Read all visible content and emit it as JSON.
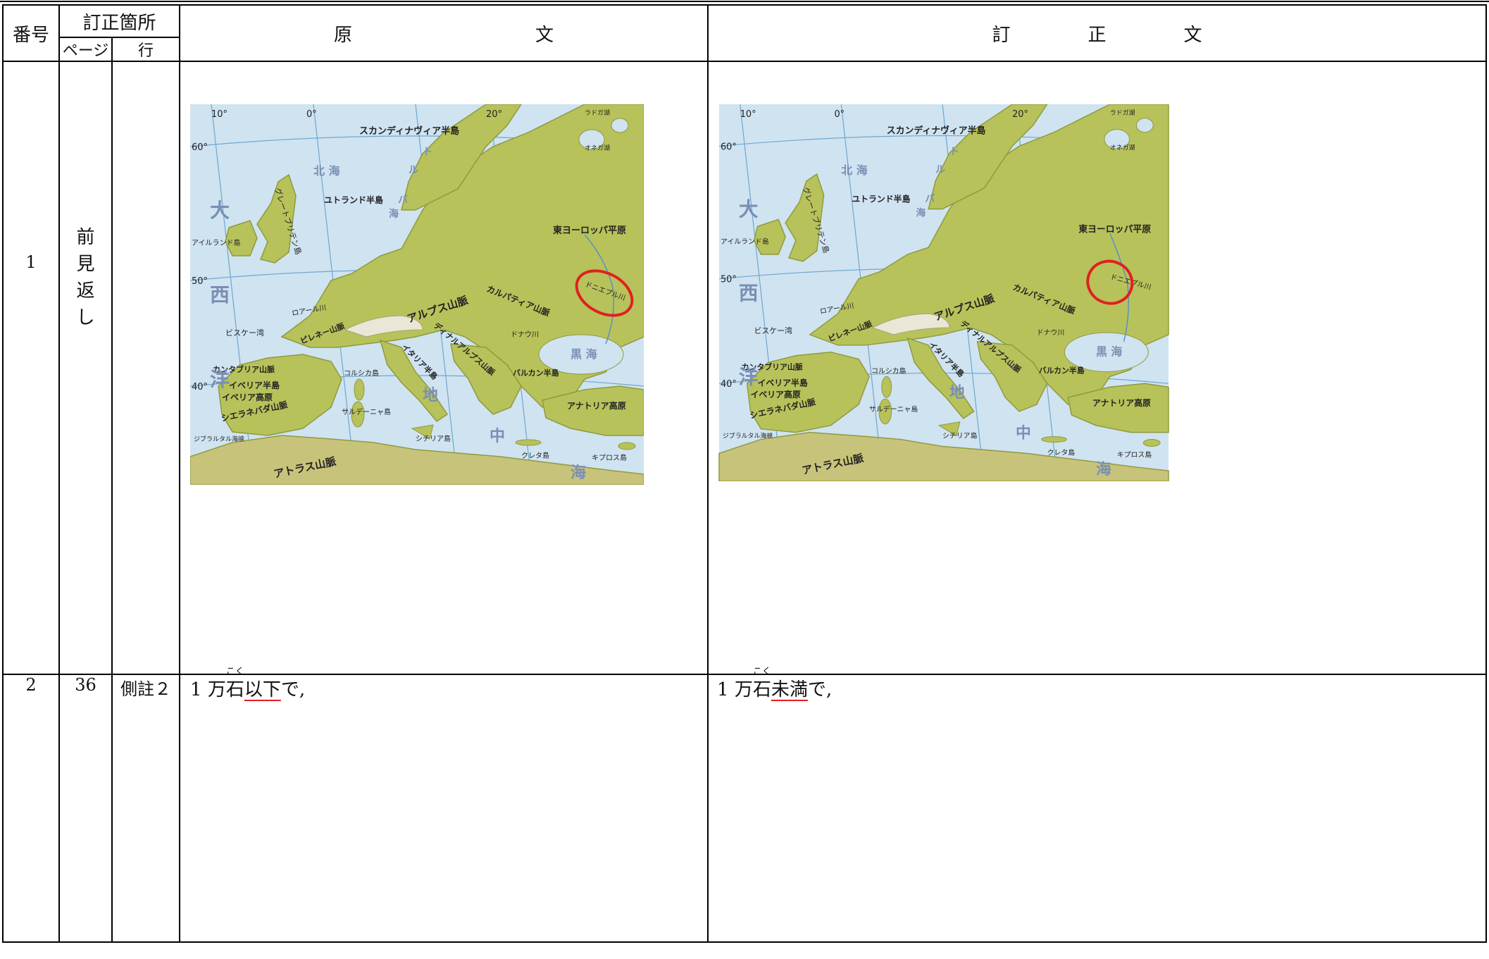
{
  "header": {
    "no_label": "番号",
    "location_label": "訂正箇所",
    "page_label": "ページ",
    "line_label": "行",
    "original_label_chars": [
      "原",
      "文"
    ],
    "corrected_label_chars": [
      "訂",
      "正",
      "文"
    ]
  },
  "rows": [
    {
      "no": "1",
      "page_chars": [
        "前",
        "見",
        "返",
        "し"
      ],
      "line": "",
      "map_labels": {
        "scandinavia": "スカンディナヴィア半島",
        "great_britain": "グレートブリテン島",
        "jutland": "ユトランド半島",
        "ireland": "アイルランド島",
        "east_europe_plain": "東ヨーロッパ平原",
        "original_river": "ドニエプル川",
        "corrected_river": "ドニエプル川",
        "alps": "アルプス山脈",
        "carpathians": "カルパティア山脈",
        "dinaric": "ディナルアルプス山脈",
        "pyrenees": "ピレネー山脈",
        "cantabrian": "カンタブリア山脈",
        "iberian_pen": "イベリア半島",
        "iberian_plateau": "イベリア高原",
        "sierra_nevada": "シエラネバダ山脈",
        "corsica": "コルシカ島",
        "sardinia": "サルデーニャ島",
        "sicily": "シチリア島",
        "italian_pen": "イタリア半島",
        "balkan": "バルカン半島",
        "anatolia": "アナトリア高原",
        "crete": "クレタ島",
        "cyprus": "キプロス島",
        "atlas": "アトラス山脈",
        "biscay": "ビスケー湾",
        "gibraltar": "ジブラルタル海峡",
        "ladoga": "ラドガ湖",
        "onega": "オネガ湖",
        "loire": "ロアール川",
        "danube": "ドナウ川",
        "ocean_chars": [
          "大",
          "西",
          "洋"
        ],
        "north_sea": "北 海",
        "baltic_chars": [
          "バ",
          "ル",
          "ト",
          "海"
        ],
        "black_sea": "黒 海",
        "med_chars": [
          "地",
          "中",
          "海"
        ],
        "lat_60": "60°",
        "lat_50": "50°",
        "lat_40": "40°",
        "lon_10w": "10°",
        "lon_0": "0°",
        "lon_20": "20°"
      }
    },
    {
      "no": "2",
      "page": "36",
      "line": "側註２",
      "original": {
        "prefix": "1 万",
        "ruby_base": "石",
        "ruby_text": "こく",
        "changed": "以下",
        "suffix": "で,"
      },
      "corrected": {
        "prefix": "1 万",
        "ruby_base": "石",
        "ruby_text": "こく",
        "changed": "未満",
        "suffix": "で,"
      }
    }
  ],
  "colors": {
    "underline": "#e02020",
    "circle": "#e02020",
    "land": "#b7c25a",
    "sea": "#cfe3f1"
  }
}
